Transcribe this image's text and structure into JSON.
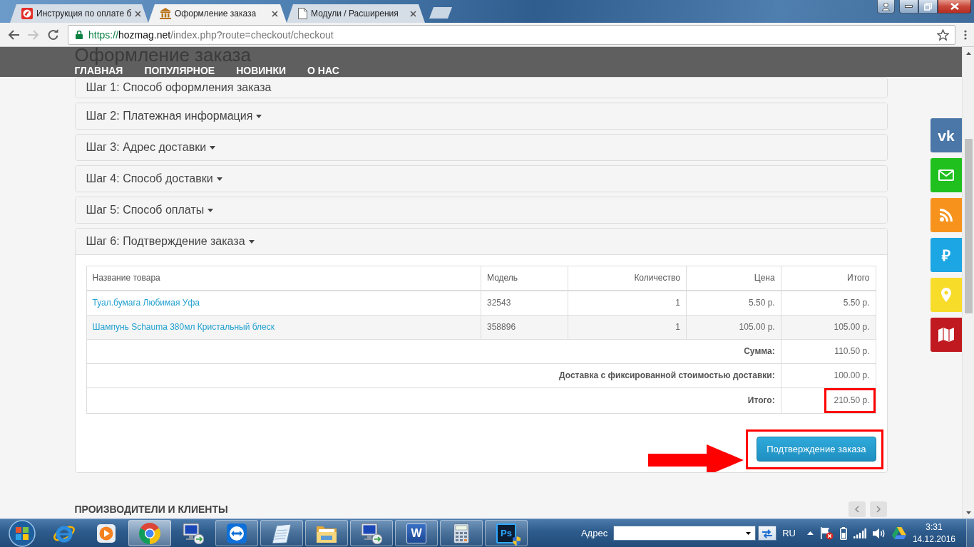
{
  "browser": {
    "tabs": [
      {
        "title": "Инструкция по оплате б",
        "kind": "logo",
        "selected": false
      },
      {
        "title": "Оформление заказа",
        "kind": "columns",
        "selected": true
      },
      {
        "title": "Модули / Расширения",
        "kind": "page",
        "selected": false
      }
    ],
    "forward_disabled": true,
    "url": {
      "scheme": "https://",
      "host": "hozmag.net",
      "path": "/index.php?route=checkout/checkout"
    }
  },
  "page": {
    "title": "Оформление заказа",
    "nav": [
      "ГЛАВНАЯ",
      "ПОПУЛЯРНОЕ",
      "НОВИНКИ",
      "О НАС"
    ],
    "steps": [
      {
        "label": "Шаг 1: Способ оформления заказа",
        "caret": false,
        "expanded": false
      },
      {
        "label": "Шаг 2: Платежная информация",
        "caret": true,
        "expanded": false
      },
      {
        "label": "Шаг 3: Адрес доставки",
        "caret": true,
        "expanded": false
      },
      {
        "label": "Шаг 4: Способ доставки",
        "caret": true,
        "expanded": false
      },
      {
        "label": "Шаг 5: Способ оплаты",
        "caret": true,
        "expanded": false
      },
      {
        "label": "Шаг 6: Подтверждение заказа",
        "caret": true,
        "expanded": true
      }
    ],
    "order": {
      "columns": [
        "Название товара",
        "Модель",
        "Количество",
        "Цена",
        "Итого"
      ],
      "rows": [
        {
          "name": "Туал.бумага Любимая Уфа",
          "model": "32543",
          "quantity": "1",
          "price": "5.50 р.",
          "total": "5.50 р."
        },
        {
          "name": "Шампунь Schauma 380мл Кристальный блеск",
          "model": "358896",
          "quantity": "1",
          "price": "105.00 р.",
          "total": "105.00 р."
        }
      ],
      "totals": [
        {
          "label": "Сумма:",
          "value": "110.50 р.",
          "highlighted": false
        },
        {
          "label": "Доставка с фиксированной стоимостью доставки:",
          "value": "100.00 р.",
          "highlighted": false
        },
        {
          "label": "Итого:",
          "value": "210.50 р.",
          "highlighted": true
        }
      ]
    },
    "confirm_button": {
      "label": "Подтверждение заказа",
      "highlighted": true
    },
    "section_heading": "ПРОИЗВОДИТЕЛИ И КЛИЕНТЫ",
    "social": [
      {
        "kind": "vk",
        "glyph": "vk",
        "color": "#4a76a8"
      },
      {
        "kind": "mail",
        "color": "#20c01f"
      },
      {
        "kind": "rss",
        "color": "#f7931d"
      },
      {
        "kind": "ruble",
        "glyph": "₽",
        "color": "#1ca6e3"
      },
      {
        "kind": "pin",
        "color": "#f7dc2a"
      },
      {
        "kind": "map",
        "color": "#c0191f"
      }
    ]
  },
  "taskbar": {
    "apps": [
      {
        "kind": "ie",
        "running": false,
        "selected": false
      },
      {
        "kind": "media",
        "running": false,
        "selected": false
      },
      {
        "kind": "chrome",
        "running": true,
        "selected": true
      },
      {
        "kind": "remote",
        "running": false,
        "selected": false
      },
      {
        "kind": "teamviewer",
        "running": true,
        "selected": false
      },
      {
        "kind": "notepad",
        "running": true,
        "selected": false
      },
      {
        "kind": "explorer",
        "running": true,
        "selected": false
      },
      {
        "kind": "remote",
        "running": true,
        "selected": false
      },
      {
        "kind": "word",
        "glyph": "W",
        "running": true,
        "selected": false
      },
      {
        "kind": "calculator",
        "running": true,
        "selected": false
      },
      {
        "kind": "photoshop",
        "glyph": "Ps",
        "running": true,
        "selected": false
      }
    ],
    "address_label": "Адрес",
    "language": "RU",
    "time": "3:31",
    "date": "14.12.2016"
  }
}
